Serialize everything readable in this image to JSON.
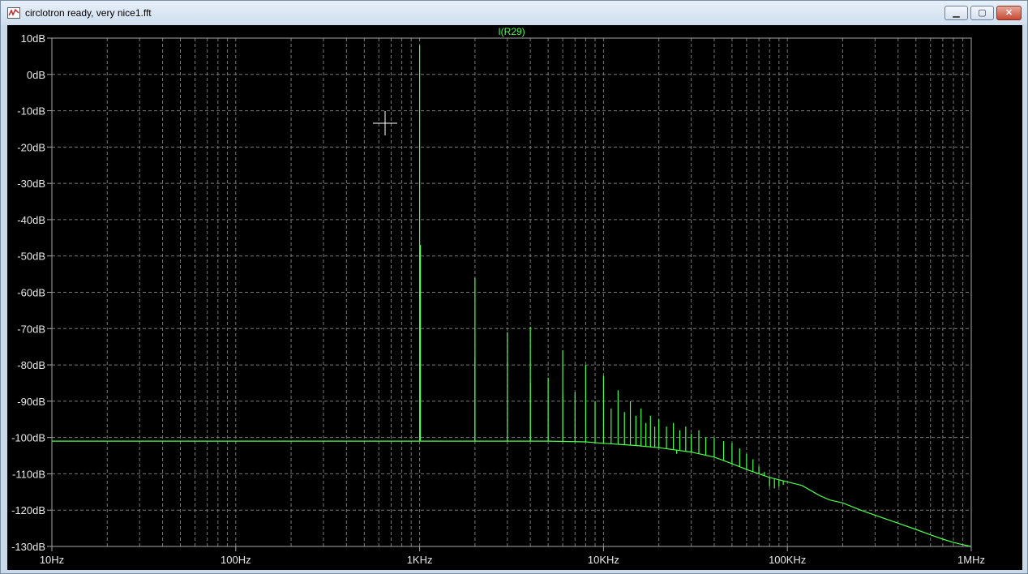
{
  "window": {
    "title": "circlotron ready, very nice1.fft",
    "icons": {
      "app": "waveform-icon",
      "minimize": "minimize-icon",
      "maximize": "maximize-icon",
      "close": "close-icon"
    },
    "buttons": {
      "minimize": "▁",
      "maximize": "▢",
      "close": "✕"
    }
  },
  "colors": {
    "background": "#000000",
    "trace": "#4cff4c",
    "grid": "#7a7a7a",
    "axis_text": "#e8e8e8",
    "frame": "#a6a6a6"
  },
  "chart_data": {
    "type": "line",
    "title": "I(R29)",
    "x_scale": "log",
    "y_scale": "dB",
    "xlim": [
      10,
      1000000
    ],
    "ylim": [
      -130,
      10
    ],
    "grid": true,
    "x_ticks": [
      {
        "value": 10,
        "label": "10Hz"
      },
      {
        "value": 100,
        "label": "100Hz"
      },
      {
        "value": 1000,
        "label": "1KHz"
      },
      {
        "value": 10000,
        "label": "10KHz"
      },
      {
        "value": 100000,
        "label": "100KHz"
      },
      {
        "value": 1000000,
        "label": "1MHz"
      }
    ],
    "y_ticks": [
      {
        "value": 10,
        "label": "10dB"
      },
      {
        "value": 0,
        "label": "0dB"
      },
      {
        "value": -10,
        "label": "-10dB"
      },
      {
        "value": -20,
        "label": "-20dB"
      },
      {
        "value": -30,
        "label": "-30dB"
      },
      {
        "value": -40,
        "label": "-40dB"
      },
      {
        "value": -50,
        "label": "-50dB"
      },
      {
        "value": -60,
        "label": "-60dB"
      },
      {
        "value": -70,
        "label": "-70dB"
      },
      {
        "value": -80,
        "label": "-80dB"
      },
      {
        "value": -90,
        "label": "-90dB"
      },
      {
        "value": -100,
        "label": "-100dB"
      },
      {
        "value": -110,
        "label": "-110dB"
      },
      {
        "value": -120,
        "label": "-120dB"
      },
      {
        "value": -130,
        "label": "-130dB"
      }
    ],
    "series": [
      {
        "noise_floor": [
          [
            10,
            -101
          ],
          [
            1000,
            -101
          ],
          [
            5000,
            -101
          ],
          [
            8000,
            -101.2
          ],
          [
            10000,
            -101.6
          ],
          [
            15000,
            -102.2
          ],
          [
            20000,
            -102.8
          ],
          [
            30000,
            -104
          ],
          [
            40000,
            -105.4
          ],
          [
            50000,
            -107.2
          ],
          [
            60000,
            -108.8
          ],
          [
            70000,
            -110
          ],
          [
            80000,
            -111
          ],
          [
            100000,
            -112.2
          ],
          [
            120000,
            -113.2
          ],
          [
            150000,
            -116
          ],
          [
            170000,
            -117.2
          ],
          [
            200000,
            -118
          ],
          [
            250000,
            -120
          ],
          [
            300000,
            -121.4
          ],
          [
            400000,
            -123.6
          ],
          [
            500000,
            -125.3
          ],
          [
            600000,
            -126.8
          ],
          [
            700000,
            -128
          ],
          [
            800000,
            -128.9
          ],
          [
            900000,
            -129.5
          ],
          [
            1000000,
            -130
          ]
        ],
        "peaks": [
          {
            "f": 1000,
            "db": 8
          },
          {
            "f": 1010,
            "db": -47
          },
          {
            "f": 2000,
            "db": -56
          },
          {
            "f": 3000,
            "db": -71
          },
          {
            "f": 4000,
            "db": -69.5
          },
          {
            "f": 5000,
            "db": -83.5
          },
          {
            "f": 6000,
            "db": -76
          },
          {
            "f": 7000,
            "db": -87.5
          },
          {
            "f": 8000,
            "db": -80
          },
          {
            "f": 9000,
            "db": -90
          },
          {
            "f": 10000,
            "db": -83
          },
          {
            "f": 11000,
            "db": -92
          },
          {
            "f": 12000,
            "db": -87
          },
          {
            "f": 13000,
            "db": -93
          },
          {
            "f": 14000,
            "db": -90
          },
          {
            "f": 15000,
            "db": -94
          },
          {
            "f": 16000,
            "db": -92
          },
          {
            "f": 17000,
            "db": -96
          },
          {
            "f": 18000,
            "db": -94
          },
          {
            "f": 19000,
            "db": -97
          },
          {
            "f": 20000,
            "db": -95
          },
          {
            "f": 22000,
            "db": -97
          },
          {
            "f": 24000,
            "db": -96
          },
          {
            "f": 26000,
            "db": -98
          },
          {
            "f": 28000,
            "db": -97
          },
          {
            "f": 30000,
            "db": -99
          },
          {
            "f": 33000,
            "db": -98
          },
          {
            "f": 36000,
            "db": -100
          },
          {
            "f": 40000,
            "db": -100
          },
          {
            "f": 45000,
            "db": -101
          },
          {
            "f": 50000,
            "db": -101.5
          },
          {
            "f": 55000,
            "db": -103
          },
          {
            "f": 60000,
            "db": -104.5
          },
          {
            "f": 65000,
            "db": -106
          },
          {
            "f": 70000,
            "db": -108
          },
          {
            "f": 75000,
            "db": -109.5
          }
        ],
        "dips": [
          {
            "f": 2000,
            "db": -78
          },
          {
            "f": 4000,
            "db": -85
          },
          {
            "f": 6000,
            "db": -88
          },
          {
            "f": 25000,
            "db": -104.5
          },
          {
            "f": 80000,
            "db": -113.5
          },
          {
            "f": 85000,
            "db": -114
          },
          {
            "f": 90000,
            "db": -113.5
          },
          {
            "f": 95000,
            "db": -113
          }
        ]
      }
    ]
  }
}
